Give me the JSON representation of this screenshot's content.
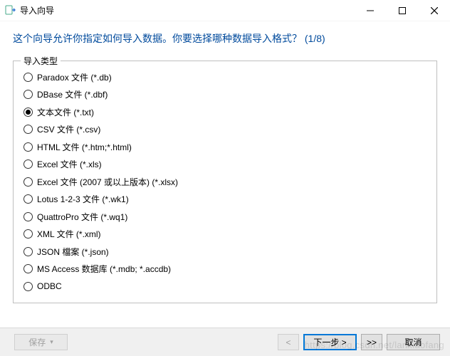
{
  "window": {
    "title": "导入向导"
  },
  "header": {
    "prompt": "这个向导允许你指定如何导入数据。你要选择哪种数据导入格式？ (1/8)"
  },
  "group": {
    "legend": "导入类型",
    "selected_index": 2,
    "options": [
      {
        "label": "Paradox 文件 (*.db)"
      },
      {
        "label": "DBase 文件 (*.dbf)"
      },
      {
        "label": "文本文件 (*.txt)"
      },
      {
        "label": "CSV 文件 (*.csv)"
      },
      {
        "label": "HTML 文件 (*.htm;*.html)"
      },
      {
        "label": "Excel 文件 (*.xls)"
      },
      {
        "label": "Excel 文件 (2007 或以上版本) (*.xlsx)"
      },
      {
        "label": "Lotus 1-2-3 文件 (*.wk1)"
      },
      {
        "label": "QuattroPro 文件 (*.wq1)"
      },
      {
        "label": "XML 文件 (*.xml)"
      },
      {
        "label": "JSON 檔案 (*.json)"
      },
      {
        "label": "MS Access 数据库 (*.mdb; *.accdb)"
      },
      {
        "label": "ODBC"
      }
    ]
  },
  "footer": {
    "save": "保存",
    "save_caret": "▾",
    "back": "<",
    "next": "下一步 >",
    "last": ">>",
    "cancel": "取消"
  },
  "watermark": "https://blog.csdn.net/lanxiaofang"
}
